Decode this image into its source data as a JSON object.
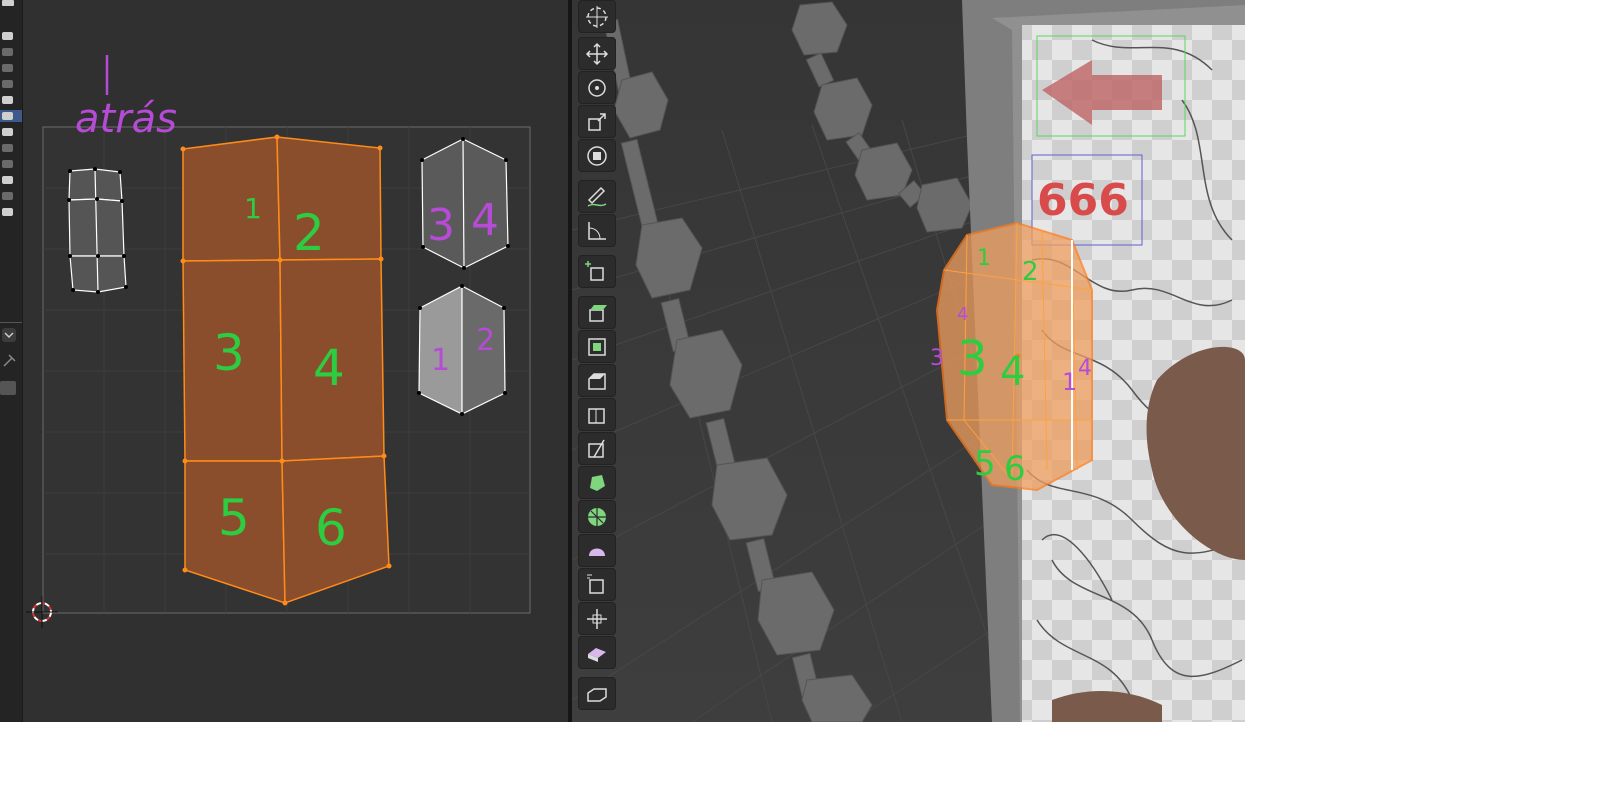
{
  "uv_editor": {
    "annotation_title": "atrás",
    "main_island_labels": [
      "1",
      "2",
      "3",
      "4",
      "5",
      "6"
    ],
    "top_right_island_labels": [
      "3",
      "4"
    ],
    "bottom_right_island_labels": [
      "1",
      "2"
    ]
  },
  "viewport": {
    "poster_number": "666",
    "mesh_face_labels": [
      "1",
      "2",
      "3",
      "4",
      "5",
      "6"
    ],
    "mesh_side_labels": [
      "4",
      "3",
      "1",
      "4"
    ]
  },
  "toolbar": {
    "tools": [
      {
        "name": "cursor-icon"
      },
      {
        "name": "move-icon"
      },
      {
        "name": "rotate-icon"
      },
      {
        "name": "scale-icon"
      },
      {
        "name": "transform-icon"
      },
      {
        "name": "annotate-icon"
      },
      {
        "name": "measure-icon"
      },
      {
        "name": "add-cube-icon"
      },
      {
        "name": "extrude-icon"
      },
      {
        "name": "inset-icon"
      },
      {
        "name": "bevel-icon"
      },
      {
        "name": "loop-cut-icon"
      },
      {
        "name": "knife-icon"
      },
      {
        "name": "poly-build-icon"
      },
      {
        "name": "spin-icon"
      },
      {
        "name": "smooth-icon"
      },
      {
        "name": "edge-slide-icon"
      },
      {
        "name": "shrink-fatten-icon"
      },
      {
        "name": "shear-icon"
      },
      {
        "name": "rip-icon"
      }
    ]
  },
  "colors": {
    "uv_face": "#8a4e2c",
    "uv_edge": "#ff8c1a",
    "annotation_green": "#2ecc40",
    "annotation_purple": "#b64bd6",
    "poster_red": "#d94a4a"
  }
}
